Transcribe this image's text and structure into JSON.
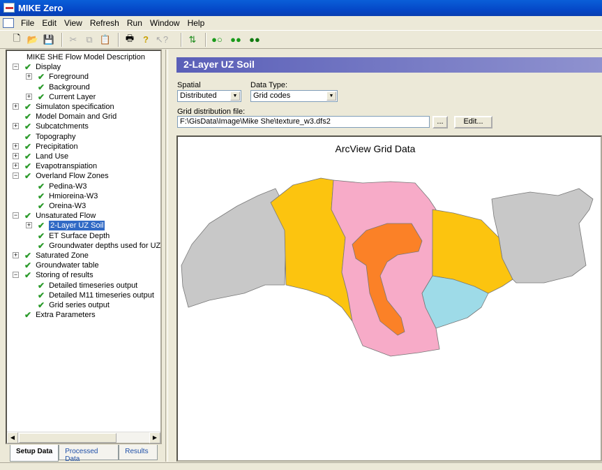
{
  "app": {
    "title": "MIKE Zero"
  },
  "menu": [
    "File",
    "Edit",
    "View",
    "Refresh",
    "Run",
    "Window",
    "Help"
  ],
  "toolbar": [
    "new-file-icon",
    "open-folder-icon",
    "save-icon",
    "cut-icon",
    "copy-icon",
    "paste-icon",
    "print-icon",
    "help-icon",
    "context-help-icon",
    "refresh-icon",
    "run-icon-1",
    "run-icon-2",
    "run-icon-3"
  ],
  "tree": [
    {
      "label": "MIKE SHE Flow Model Description",
      "level": 0,
      "expander": "",
      "check": false
    },
    {
      "label": "Display",
      "level": 1,
      "expander": "-",
      "check": true
    },
    {
      "label": "Foreground",
      "level": 2,
      "expander": "+",
      "check": true
    },
    {
      "label": "Background",
      "level": 2,
      "expander": "",
      "check": true
    },
    {
      "label": "Current Layer",
      "level": 2,
      "expander": "+",
      "check": true
    },
    {
      "label": "Simulaton specification",
      "level": 1,
      "expander": "+",
      "check": true
    },
    {
      "label": "Model Domain and Grid",
      "level": 1,
      "expander": "",
      "check": true
    },
    {
      "label": "Subcatchments",
      "level": 1,
      "expander": "+",
      "check": true
    },
    {
      "label": "Topography",
      "level": 1,
      "expander": "",
      "check": true
    },
    {
      "label": "Precipitation",
      "level": 1,
      "expander": "+",
      "check": true
    },
    {
      "label": "Land Use",
      "level": 1,
      "expander": "+",
      "check": true
    },
    {
      "label": "Evapotranspiation",
      "level": 1,
      "expander": "+",
      "check": true
    },
    {
      "label": "Overland Flow Zones",
      "level": 1,
      "expander": "-",
      "check": true
    },
    {
      "label": "Pedina-W3",
      "level": 2,
      "expander": "",
      "check": true
    },
    {
      "label": "Hmioreina-W3",
      "level": 2,
      "expander": "",
      "check": true
    },
    {
      "label": "Oreina-W3",
      "level": 2,
      "expander": "",
      "check": true
    },
    {
      "label": "Unsaturated Flow",
      "level": 1,
      "expander": "-",
      "check": true
    },
    {
      "label": "2-Layer UZ Soil",
      "level": 2,
      "expander": "+",
      "check": true,
      "selected": true
    },
    {
      "label": "ET Surface Depth",
      "level": 2,
      "expander": "",
      "check": true
    },
    {
      "label": "Groundwater depths used for UZ",
      "level": 2,
      "expander": "",
      "check": true
    },
    {
      "label": "Saturated Zone",
      "level": 1,
      "expander": "+",
      "check": true
    },
    {
      "label": "Groundwater table",
      "level": 1,
      "expander": "",
      "check": true
    },
    {
      "label": "Storing of results",
      "level": 1,
      "expander": "-",
      "check": true
    },
    {
      "label": "Detailed timeseries output",
      "level": 2,
      "expander": "",
      "check": true
    },
    {
      "label": "Detailed M11 timeseries output",
      "level": 2,
      "expander": "",
      "check": true
    },
    {
      "label": "Grid series output",
      "level": 2,
      "expander": "",
      "check": true
    },
    {
      "label": "Extra Parameters",
      "level": 1,
      "expander": "",
      "check": true
    }
  ],
  "tabs": [
    "Setup Data",
    "Processed Data",
    "Results"
  ],
  "panel": {
    "header": "2-Layer UZ Soil",
    "spatial_label": "Spatial",
    "spatial_value": "Distributed",
    "datatype_label": "Data Type:",
    "datatype_value": "Grid codes",
    "file_label": "Grid distribution file:",
    "file_value": "F:\\GisData\\Image\\Mike She\\texture_w3.dfs2",
    "browse_label": "...",
    "edit_label": "Edit...",
    "map_title": "ArcView Grid Data"
  },
  "map_colors": {
    "gray": "#c8c8c8",
    "yellow": "#fcc40f",
    "pink": "#f7abc8",
    "orange": "#fb8127",
    "cyan": "#9edbe8"
  }
}
